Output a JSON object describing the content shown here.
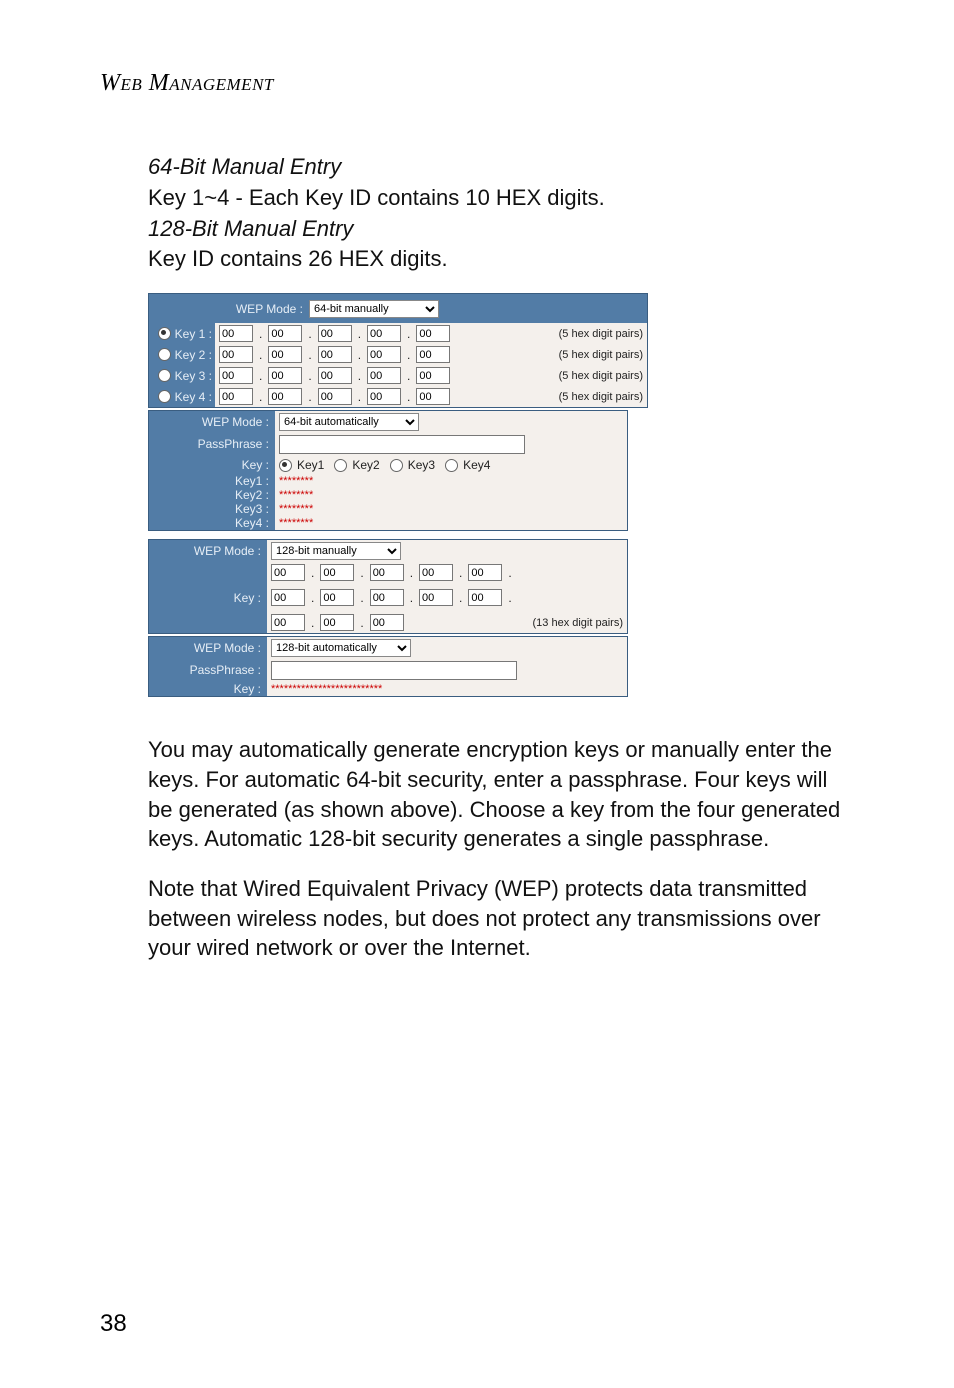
{
  "page": {
    "header": "Web Management",
    "page_number": "38"
  },
  "intro": {
    "h64": "64-Bit Manual Entry",
    "l64": "Key 1~4 - Each Key ID contains 10 HEX digits.",
    "h128": "128-Bit Manual Entry",
    "l128": "Key ID contains 26 HEX digits."
  },
  "ui": {
    "wep_mode_label": "WEP Mode :",
    "passphrase_label": "PassPhrase :",
    "key_label": "Key :",
    "key1_label": "Key 1 :",
    "key2_label": "Key 2 :",
    "key3_label": "Key 3 :",
    "key4_label": "Key 4 :",
    "keyrow1": "Key1 :",
    "keyrow2": "Key2 :",
    "keyrow3": "Key3 :",
    "keyrow4": "Key4 :",
    "radio_key1": "Key1",
    "radio_key2": "Key2",
    "radio_key3": "Key3",
    "radio_key4": "Key4",
    "mode_64m": "64-bit manually",
    "mode_64a": "64-bit automatically",
    "mode_128m": "128-bit manually",
    "mode_128a": "128-bit automatically",
    "hex_val": "00",
    "hint5": "(5 hex digit pairs)",
    "hint13": "(13 hex digit pairs)",
    "stars8": "********",
    "stars26": "**************************"
  },
  "body": {
    "p1": "You may automatically generate encryption keys or manually enter the keys. For automatic 64-bit security, enter a passphrase. Four keys will be generated (as shown above). Choose a key from the four generated keys. Automatic 128-bit security generates a single passphrase.",
    "p2": "Note that Wired Equivalent Privacy (WEP) protects data transmitted between wireless nodes, but does not protect any transmissions over your wired network or over the Internet."
  }
}
